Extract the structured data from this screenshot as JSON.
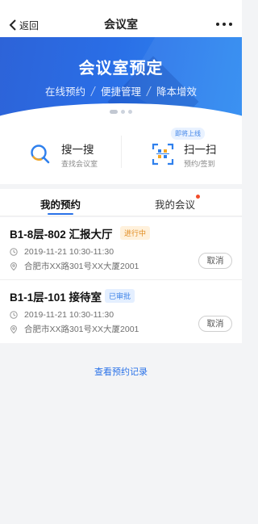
{
  "nav": {
    "back_label": "返回",
    "title": "会议室",
    "more_icon": "more-icon"
  },
  "banner": {
    "headline": "会议室预定",
    "features": [
      "在线预约",
      "便捷管理",
      "降本增效"
    ]
  },
  "quick": {
    "search": {
      "title": "搜一搜",
      "subtitle": "查找会议室",
      "icon": "search-icon"
    },
    "scan": {
      "title": "扫一扫",
      "subtitle": "预约/签到",
      "badge": "即将上线",
      "icon": "scan-icon"
    }
  },
  "tabs": [
    "我的预约",
    "我的会议"
  ],
  "reservations": [
    {
      "room": "B1-8层-802 汇报大厅",
      "status": "进行中",
      "time": "2019-11-21 10:30-11:30",
      "address": "合肥市XX路301号XX大厦2001",
      "cancel": "取消"
    },
    {
      "room": "B1-1层-101 接待室",
      "status": "已审批",
      "time": "2019-11-21 10:30-11:30",
      "address": "合肥市XX路301号XX大厦2001",
      "cancel": "取消"
    }
  ],
  "history_link": "查看预约记录",
  "colors": {
    "accent": "#2a72e8",
    "ongoing": "#e08a1e",
    "approved": "#3f84e8",
    "notify_dot": "#f24c2a"
  }
}
